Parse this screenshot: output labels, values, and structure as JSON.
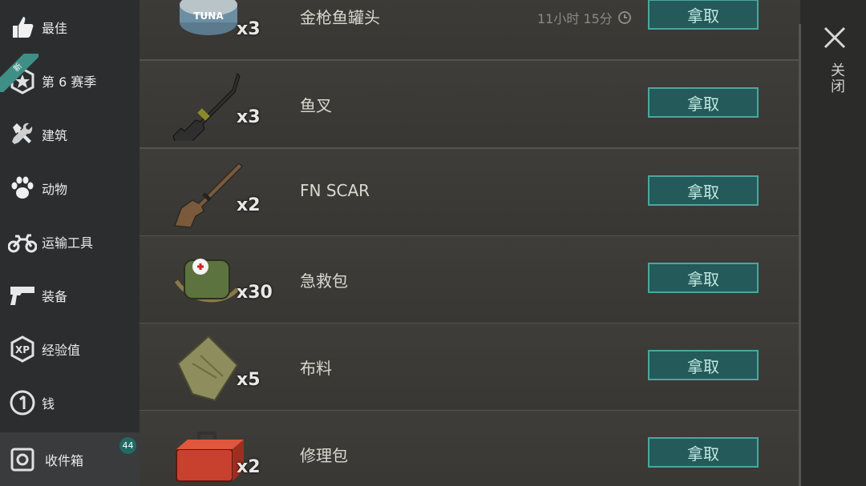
{
  "sidebar": {
    "items": [
      {
        "label": "最佳",
        "icon": "thumbs-up-icon"
      },
      {
        "label": "第 6 赛季",
        "icon": "season-star-icon",
        "ribbon": "新"
      },
      {
        "label": "建筑",
        "icon": "tools-icon"
      },
      {
        "label": "动物",
        "icon": "paw-icon"
      },
      {
        "label": "运输工具",
        "icon": "motorcycle-icon"
      },
      {
        "label": "装备",
        "icon": "pistol-icon"
      },
      {
        "label": "经验值",
        "icon": "xp-icon"
      },
      {
        "label": "钱",
        "icon": "coin-icon"
      }
    ],
    "inbox": {
      "label": "收件箱",
      "badge": "44",
      "icon": "safe-icon"
    }
  },
  "list": {
    "take_label": "拿取",
    "rows": [
      {
        "name": "金枪鱼罐头",
        "qty": "x3",
        "timer": "11小时 15分",
        "icon": "tuna-can-icon"
      },
      {
        "name": "鱼叉",
        "qty": "x3",
        "icon": "harpoon-gun-icon"
      },
      {
        "name": "FN SCAR",
        "qty": "x2",
        "icon": "rifle-icon"
      },
      {
        "name": "急救包",
        "qty": "x30",
        "icon": "first-aid-bag-icon"
      },
      {
        "name": "布料",
        "qty": "x5",
        "icon": "cloth-icon"
      },
      {
        "name": "修理包",
        "qty": "x2",
        "icon": "toolbox-icon"
      }
    ]
  },
  "close": {
    "label": "关闭",
    "icon": "close-icon"
  },
  "colors": {
    "accent": "#4aa6a0",
    "button_bg": "#245a59",
    "sidebar_bg": "#2c2d2e",
    "row_bg": "#3c3a36"
  }
}
